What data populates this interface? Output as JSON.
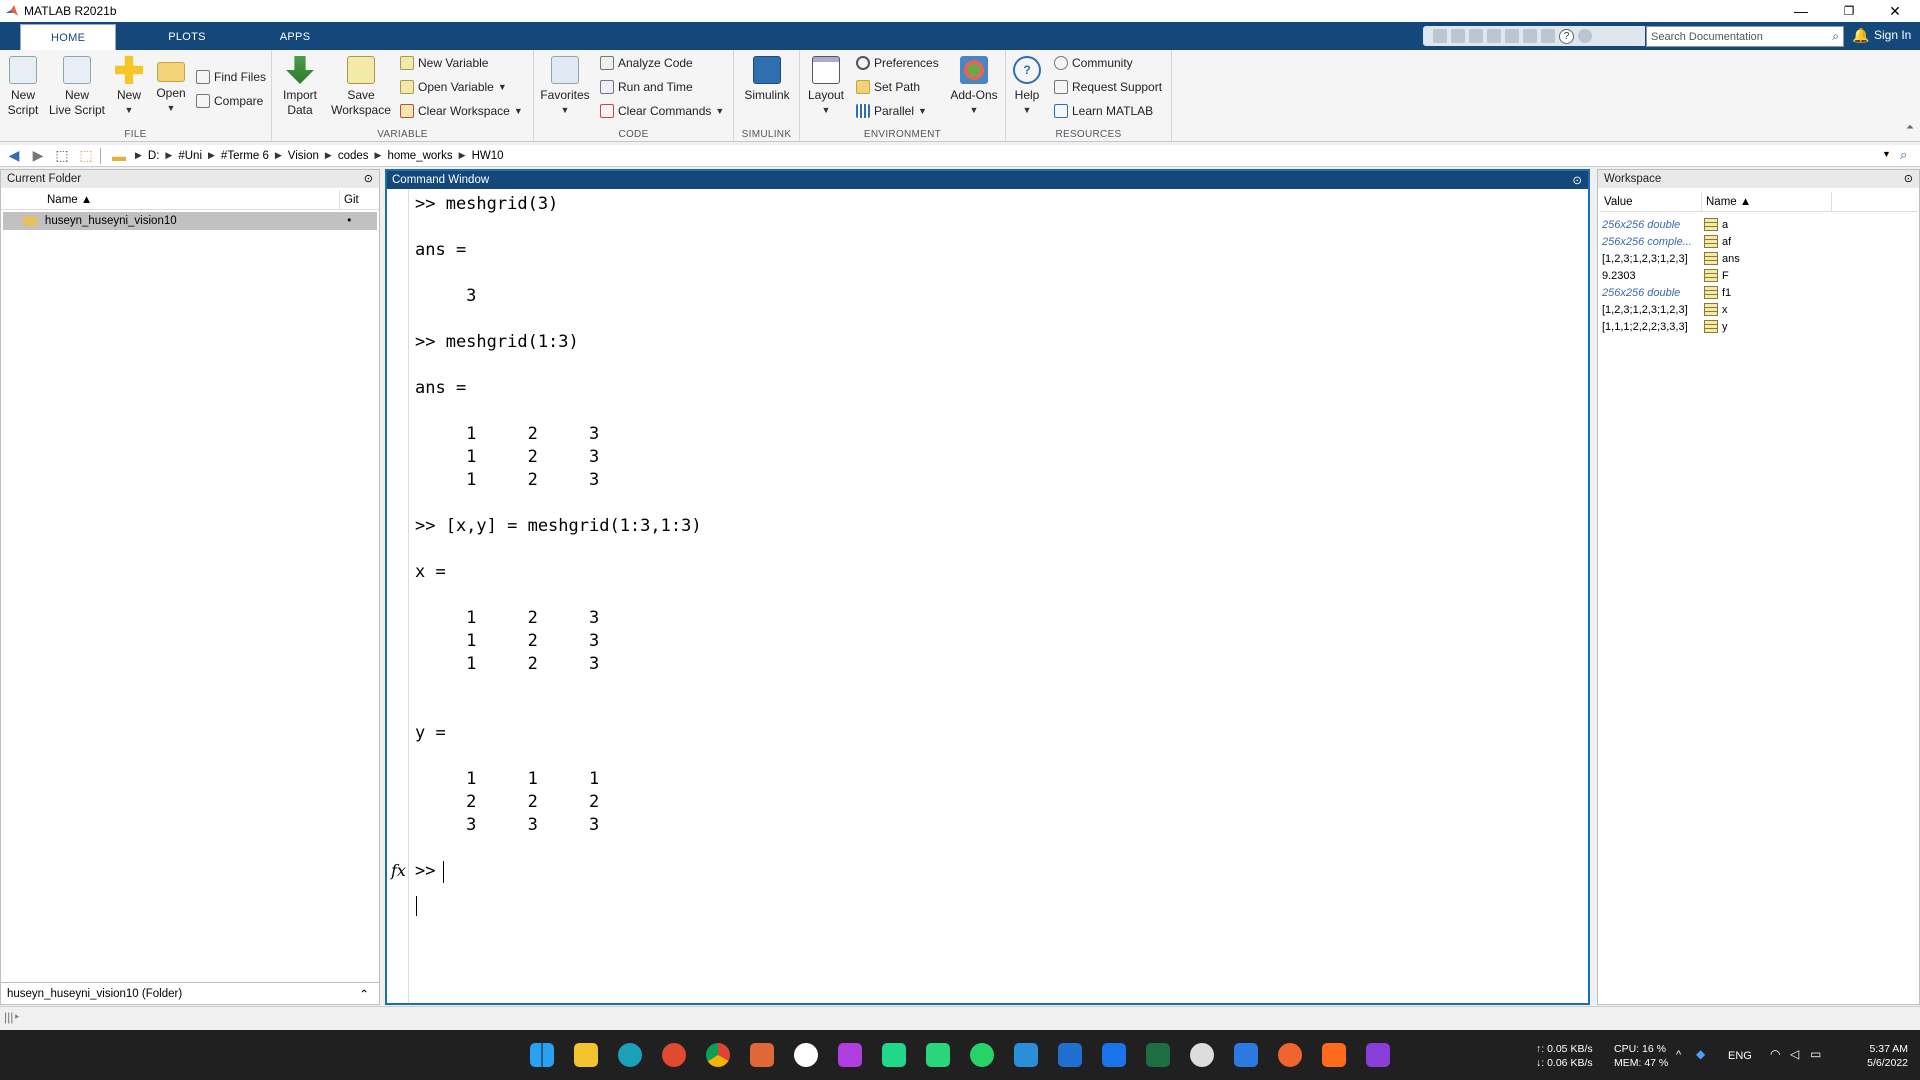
{
  "window": {
    "title": "MATLAB R2021b",
    "min": "—",
    "max": "❐",
    "close": "✕"
  },
  "tabs": [
    "HOME",
    "PLOTS",
    "APPS"
  ],
  "search": {
    "placeholder": "Search Documentation"
  },
  "signin": "Sign In",
  "ribbon": {
    "file": {
      "label": "FILE",
      "new_script": "New\nScript",
      "new_live": "New\nLive Script",
      "new": "New",
      "open": "Open",
      "find_files": "Find Files",
      "compare": "Compare"
    },
    "variable": {
      "label": "VARIABLE",
      "import": "Import\nData",
      "save": "Save\nWorkspace",
      "new_var": "New Variable",
      "open_var": "Open Variable",
      "clear_ws": "Clear Workspace"
    },
    "code": {
      "label": "CODE",
      "favorites": "Favorites",
      "analyze": "Analyze Code",
      "run_time": "Run and Time",
      "clear_cmds": "Clear Commands"
    },
    "simulink": {
      "label": "SIMULINK",
      "simulink": "Simulink"
    },
    "environment": {
      "label": "ENVIRONMENT",
      "layout": "Layout",
      "prefs": "Preferences",
      "set_path": "Set Path",
      "parallel": "Parallel",
      "addons": "Add-Ons"
    },
    "resources": {
      "label": "RESOURCES",
      "help": "Help",
      "community": "Community",
      "request": "Request Support",
      "learn": "Learn MATLAB"
    }
  },
  "breadcrumb": [
    "D:",
    "#Uni",
    "#Terme 6",
    "Vision",
    "codes",
    "home_works",
    "HW10"
  ],
  "current_folder": {
    "title": "Current Folder",
    "col_name": "Name ▲",
    "col_git": "Git",
    "items": [
      {
        "name": "huseyn_huseyni_vision10",
        "git": "•"
      }
    ],
    "detail": "huseyn_huseyni_vision10  (Folder)"
  },
  "command_window": {
    "title": "Command Window",
    "text": ">> meshgrid(3)\n\nans =\n\n     3\n\n>> meshgrid(1:3)\n\nans =\n\n     1     2     3\n     1     2     3\n     1     2     3\n\n>> [x,y] = meshgrid(1:3,1:3)\n\nx =\n\n     1     2     3\n     1     2     3\n     1     2     3\n\n\ny =\n\n     1     1     1\n     2     2     2\n     3     3     3\n\n>> ",
    "fx": "fx"
  },
  "workspace": {
    "title": "Workspace",
    "col_value": "Value",
    "col_name": "Name ▲",
    "rows": [
      {
        "value": "256x256 double",
        "name": "a",
        "italic": true
      },
      {
        "value": "256x256 comple...",
        "name": "af",
        "italic": true
      },
      {
        "value": "[1,2,3;1,2,3;1,2,3]",
        "name": "ans",
        "italic": false
      },
      {
        "value": "9.2303",
        "name": "F",
        "italic": false
      },
      {
        "value": "256x256 double",
        "name": "f1",
        "italic": true
      },
      {
        "value": "[1,2,3;1,2,3;1,2,3]",
        "name": "x",
        "italic": false
      },
      {
        "value": "[1,1,1;2,2,2;3,3,3]",
        "name": "y",
        "italic": false
      }
    ]
  },
  "taskbar": {
    "net_up": "↑: 0.05 KB/s",
    "net_down": "↓: 0.06 KB/s",
    "cpu": "CPU: 16 %",
    "mem": "MEM: 47 %",
    "lang": "ENG",
    "time": "5:37 AM",
    "date": "5/6/2022"
  }
}
